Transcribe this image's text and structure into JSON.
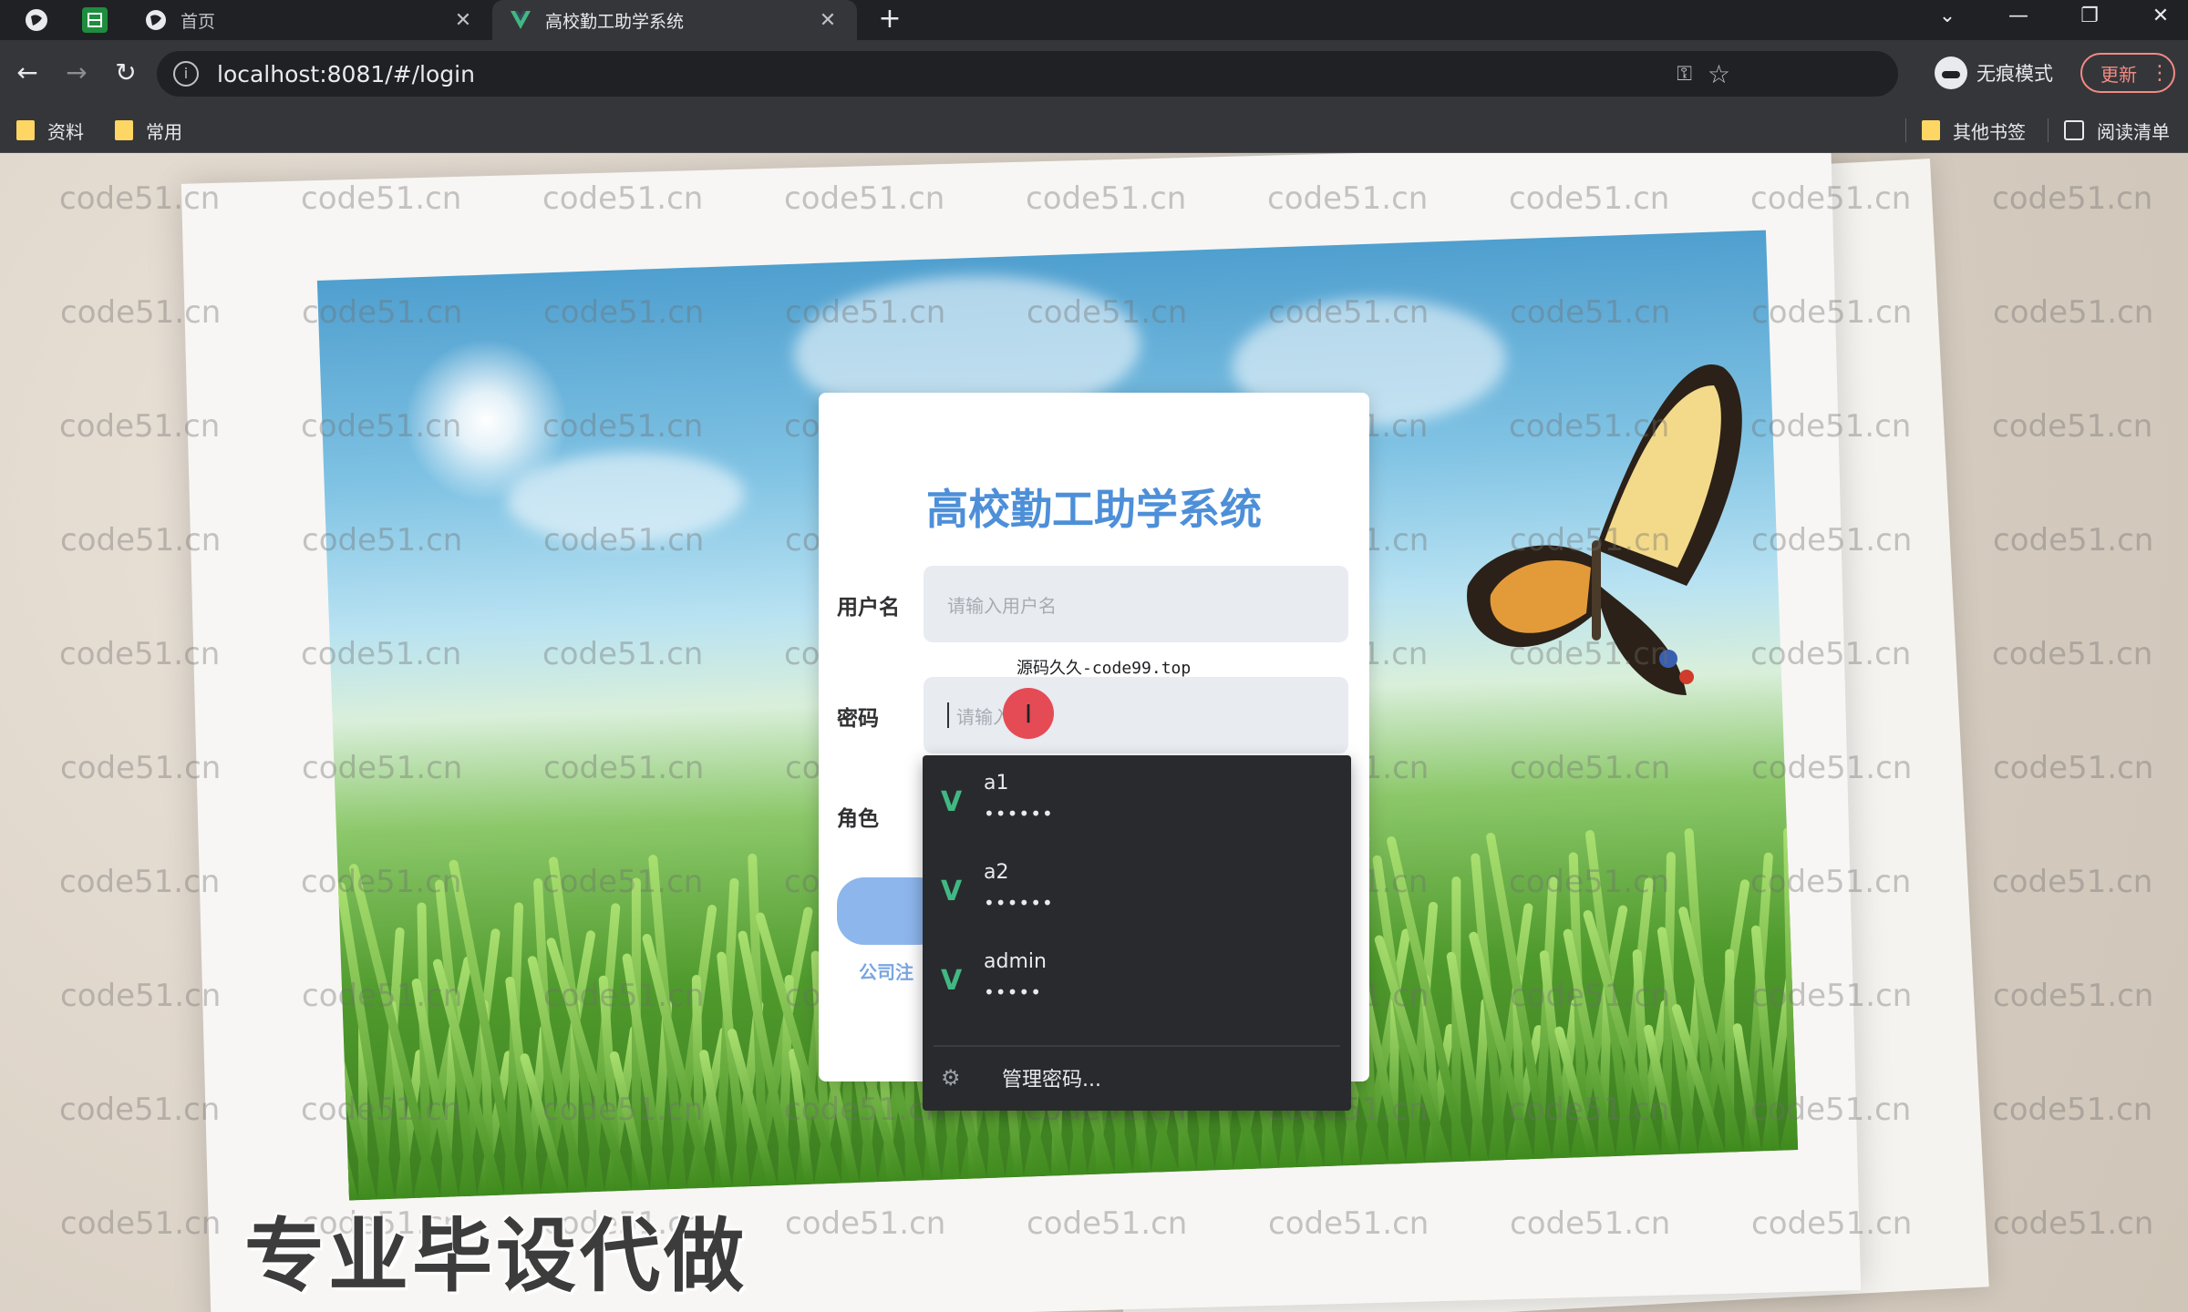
{
  "browser": {
    "tabs": [
      {
        "title": "首页",
        "active": false
      },
      {
        "title": "高校勤工助学系统",
        "active": true
      }
    ],
    "url": "localhost:8081/#/login",
    "incognito_label": "无痕模式",
    "update_label": "更新",
    "bookmarks": [
      "资料",
      "常用"
    ],
    "other_bookmarks": "其他书签",
    "reading_list": "阅读清单"
  },
  "login": {
    "title": "高校勤工助学系统",
    "username_label": "用户名",
    "username_placeholder": "请输入用户名",
    "password_label": "密码",
    "password_placeholder": "请输入",
    "role_label": "角色",
    "register_link": "公司注"
  },
  "autofill": {
    "items": [
      {
        "user": "a1",
        "password": "••••••"
      },
      {
        "user": "a2",
        "password": "••••••"
      },
      {
        "user": "admin",
        "password": "•••••"
      }
    ],
    "manage_label": "管理密码..."
  },
  "overlay": {
    "promo_small": "源码久久-code99.top",
    "promo_big": "专业毕设代做",
    "watermark": "code51.cn"
  },
  "colors": {
    "title_blue": "#4d8fd8",
    "login_button": "#8db6ec",
    "vue_green": "#41b883"
  }
}
